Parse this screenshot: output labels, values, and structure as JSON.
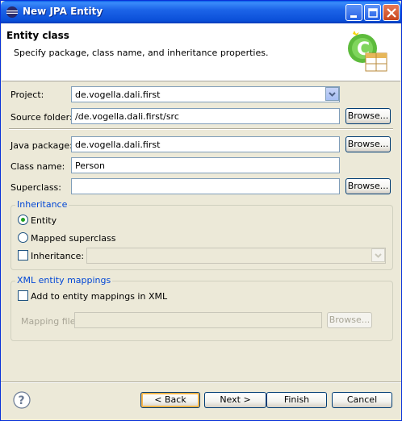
{
  "window": {
    "title": "New JPA Entity"
  },
  "banner": {
    "title": "Entity class",
    "description": "Specify package, class name, and inheritance properties."
  },
  "form": {
    "project_label": "Project:",
    "project_value": "de.vogella.dali.first",
    "source_folder_label": "Source folder:",
    "source_folder_value": "/de.vogella.dali.first/src",
    "java_package_label": "Java package:",
    "java_package_value": "de.vogella.dali.first",
    "class_name_label": "Class name:",
    "class_name_value": "Person",
    "superclass_label": "Superclass:",
    "superclass_value": "",
    "browse_label": "Browse..."
  },
  "inheritance": {
    "group_title": "Inheritance",
    "entity_label": "Entity",
    "mapped_superclass_label": "Mapped superclass",
    "inheritance_label": "Inheritance:",
    "selected": "Entity",
    "inheritance_checked": false
  },
  "xml": {
    "group_title": "XML entity mappings",
    "add_label": "Add to entity mappings in XML",
    "add_checked": false,
    "mapping_file_label": "Mapping file:",
    "mapping_file_value": "",
    "browse_label": "Browse..."
  },
  "footer": {
    "back_label": "< Back",
    "next_label": "Next >",
    "finish_label": "Finish",
    "cancel_label": "Cancel"
  },
  "colors": {
    "titlebar": "#0a4fd8",
    "group_title": "#0046d5",
    "radio_selected": "#21a121"
  }
}
